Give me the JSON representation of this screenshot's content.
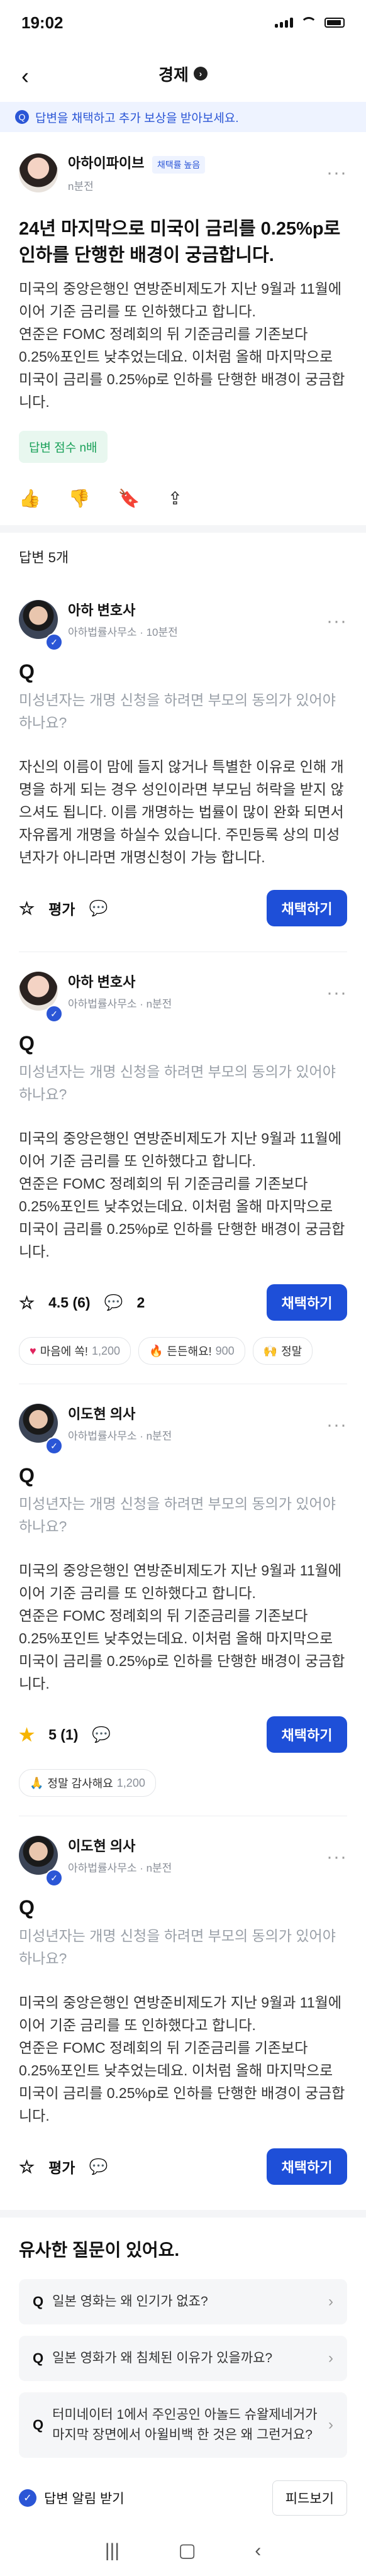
{
  "status": {
    "time": "19:02"
  },
  "nav": {
    "title": "경제",
    "back": "‹",
    "chevron": "›"
  },
  "banner": {
    "text": "답변을 채택하고 추가 보상을 받아보세요."
  },
  "question": {
    "user": "아하이파이브",
    "badge": "채택률 높음",
    "time": "n분전",
    "title": "24년 마지막으로 미국이 금리를 0.25%p로 인하를 단행한 배경이 궁금합니다.",
    "body": "미국의 중앙은행인 연방준비제도가 지난 9월과 11월에 이어 기준 금리를 또 인하했다고 합니다.\n연준은 FOMC 정례회의 뒤 기준금리를 기존보다 0.25%포인트 낮추었는데요. 이처럼 올해 마지막으로 미국이 금리를 0.25%p로 인하를 단행한 배경이 궁금합니다.",
    "points": "답변 점수 n배"
  },
  "answers_header": "답변 5개",
  "answers": [
    {
      "name": "아하 변호사",
      "sub": "아하법률사무소 · 10분전",
      "q": "미성년자는 개명 신청을 하려면 부모의 동의가 있어야 하나요?",
      "a": "자신의 이름이 맘에 들지 않거나 특별한 이유로 인해 개명을 하게 되는 경우 성인이라면 부모님 허락을 받지 않으셔도 됩니다. 이름 개명하는 법률이 많이 완화 되면서 자유롭게 개명을 하실수 있습니다. 주민등록 상의 미성년자가 아니라면 개명신청이 가능 합니다.",
      "rating": "평가",
      "comments": "",
      "adopt": "채택하기"
    },
    {
      "name": "아하 변호사",
      "sub": "아하법률사무소 · n분전",
      "q": "미성년자는 개명 신청을 하려면 부모의 동의가 있어야 하나요?",
      "a": "미국의 중앙은행인 연방준비제도가 지난 9월과 11월에 이어 기준 금리를 또 인하했다고 합니다.\n연준은 FOMC 정례회의 뒤 기준금리를 기존보다 0.25%포인트 낮추었는데요. 이처럼 올해 마지막으로 미국이 금리를 0.25%p로 인하를 단행한 배경이 궁금합니다.",
      "rating": "4.5 (6)",
      "comments": "2",
      "adopt": "채택하기"
    },
    {
      "name": "이도현 의사",
      "sub": "아하법률사무소 · n분전",
      "q": "미성년자는 개명 신청을 하려면 부모의 동의가 있어야 하나요?",
      "a": "미국의 중앙은행인 연방준비제도가 지난 9월과 11월에 이어 기준 금리를 또 인하했다고 합니다.\n연준은 FOMC 정례회의 뒤 기준금리를 기존보다 0.25%포인트 낮추었는데요. 이처럼 올해 마지막으로 미국이 금리를 0.25%p로 인하를 단행한 배경이 궁금합니다.",
      "rating": "5 (1)",
      "comments": "",
      "adopt": "채택하기"
    },
    {
      "name": "이도현 의사",
      "sub": "아하법률사무소 · n분전",
      "q": "미성년자는 개명 신청을 하려면 부모의 동의가 있어야 하나요?",
      "a": "미국의 중앙은행인 연방준비제도가 지난 9월과 11월에 이어 기준 금리를 또 인하했다고 합니다.\n연준은 FOMC 정례회의 뒤 기준금리를 기존보다 0.25%포인트 낮추었는데요. 이처럼 올해 마지막으로 미국이 금리를 0.25%p로 인하를 단행한 배경이 궁금합니다.",
      "rating": "평가",
      "comments": "",
      "adopt": "채택하기"
    }
  ],
  "reactions1": [
    {
      "icon": "♥",
      "label": "마음에 쏙!",
      "count": "1,200"
    },
    {
      "icon": "🔥",
      "label": "든든해요!",
      "count": "900"
    },
    {
      "icon": "🙌",
      "label": "정말",
      "count": ""
    }
  ],
  "reactions2": [
    {
      "icon": "🙏",
      "label": "정말 감사해요",
      "count": "1,200"
    }
  ],
  "similar": {
    "title": "유사한 질문이 있어요.",
    "items": [
      "일본 영화는 왜 인기가 없죠?",
      "일본 영화가 왜 침체된 이유가 있을까요?",
      "터미네이터 1에서 주인공인 아놀드 슈왈제네거가 마지막 장면에서 아윌비백 한 것은 왜 그런거요?"
    ]
  },
  "footer": {
    "alert": "답변 알림 받기",
    "feed": "피드보기"
  },
  "colors": {
    "accent": "#1e4fd8",
    "points_green": "#18a058",
    "star": "#f6b400"
  }
}
